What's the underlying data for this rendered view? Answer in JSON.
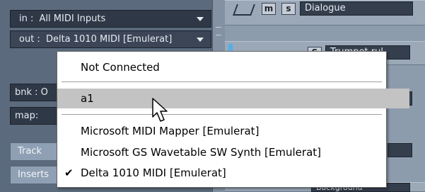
{
  "inspector": {
    "in_label": "in :",
    "in_value": "All MIDI Inputs",
    "out_label": "out :",
    "out_value": "Delta 1010 MIDI [Emulerat]",
    "bnk_label": "bnk : O",
    "map_label": "map:",
    "track_label": "Track",
    "inserts_label": "Inserts"
  },
  "tracks": {
    "dialogue": {
      "m_label": "m",
      "s_label": "s",
      "name": "Dialogue"
    },
    "second": {
      "s_label": "S",
      "name": "Trumpet rul"
    },
    "bottom_name": "Background"
  },
  "popup_menu": {
    "items": [
      {
        "label": "Not Connected",
        "selected": false,
        "highlighted": false
      },
      {
        "label": "a1",
        "selected": false,
        "highlighted": true
      },
      {
        "label": "Microsoft MIDI Mapper [Emulerat]",
        "selected": false,
        "highlighted": false
      },
      {
        "label": "Microsoft GS Wavetable SW Synth [Emulerat]",
        "selected": false,
        "highlighted": false
      },
      {
        "label": "Delta 1010 MIDI [Emulerat]",
        "selected": true,
        "highlighted": false
      }
    ],
    "checkmark": "✔"
  },
  "colors": {
    "panel": "#5b6a7d",
    "field_bg": "#2f3846",
    "menu_highlight": "#c3c3c3",
    "track_color": "#55aee6"
  }
}
